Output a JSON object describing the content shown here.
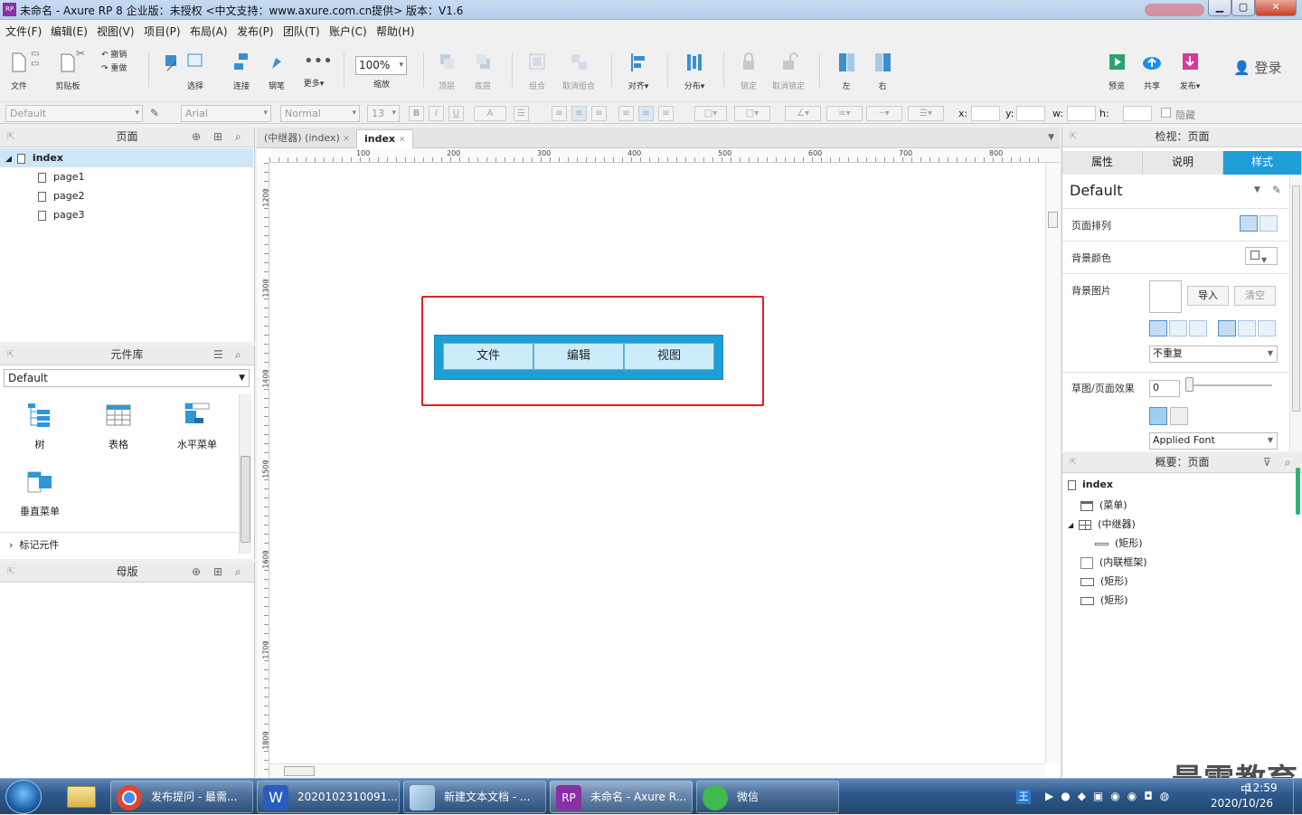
{
  "window": {
    "title": "未命名 - Axure RP 8 企业版：未授权    <中文支持：www.axure.com.cn提供> 版本：V1.6",
    "app_icon": "RP",
    "min_label": "▁",
    "max_label": "▢",
    "close_label": "✕"
  },
  "menubar": [
    "文件(F)",
    "编辑(E)",
    "视图(V)",
    "项目(P)",
    "布局(A)",
    "发布(P)",
    "团队(T)",
    "账户(C)",
    "帮助(H)"
  ],
  "toolbar": {
    "file": "文件",
    "clipboard": "剪贴板",
    "cut_icon": "✂",
    "undo": "撤销",
    "redo": "重做",
    "select": "选择",
    "connect": "连接",
    "pen": "钢笔",
    "more": "更多▾",
    "zoom_value": "100%",
    "zoom": "缩放",
    "top": "顶层",
    "bottom": "底层",
    "group": "组合",
    "ungroup": "取消组合",
    "align": "对齐▾",
    "distribute": "分布▾",
    "lock": "锁定",
    "unlock": "取消锁定",
    "left": "左",
    "right": "右",
    "preview": "预览",
    "share": "共享",
    "publish": "发布▾",
    "login": "登录"
  },
  "formatbar": {
    "style": "Default",
    "font": "Arial",
    "weight": "Normal",
    "size": "13",
    "bold": "B",
    "italic": "I",
    "underline": "U",
    "font_color": "A",
    "x_label": "x:",
    "y_label": "y:",
    "w_label": "w:",
    "h_label": "h:",
    "hidden": "隐藏"
  },
  "pages_panel": {
    "title": "页面",
    "root": "index",
    "pages": [
      "page1",
      "page2",
      "page3"
    ]
  },
  "library_panel": {
    "title": "元件库",
    "library": "Default",
    "widgets": [
      "树",
      "表格",
      "水平菜单",
      "垂直菜单"
    ],
    "section": "标记元件"
  },
  "master_panel": {
    "title": "母版"
  },
  "tabs": [
    {
      "label": "(中继器) (index)"
    },
    {
      "label": "index"
    }
  ],
  "tab_close": "✕",
  "ruler": {
    "h": [
      "100",
      "200",
      "300",
      "400",
      "500",
      "600",
      "700",
      "800"
    ],
    "v": [
      "1200",
      "1300",
      "1400",
      "1500",
      "1600",
      "1700",
      "1800"
    ]
  },
  "canvas": {
    "menu_items": [
      "文件",
      "编辑",
      "视图"
    ]
  },
  "inspector": {
    "title": "检视：页面",
    "tabs": [
      "属性",
      "说明",
      "样式"
    ],
    "style_name": "Default",
    "page_align": "页面排列",
    "bg_color": "背景颜色",
    "bg_image": "背景图片",
    "import": "导入",
    "clear": "清空",
    "repeat": "不重复",
    "sketch": "草图/页面效果",
    "sketch_value": "0",
    "font": "Applied Font"
  },
  "outline": {
    "title": "概要：页面",
    "root": "index",
    "items": [
      {
        "label": "(菜单)",
        "icon": "folder-icon"
      },
      {
        "label": "(中继器)",
        "icon": "repeater-icon"
      },
      {
        "label": "(矩形)",
        "icon": "line-icon"
      },
      {
        "label": "(内联框架)",
        "icon": "iframe-icon"
      },
      {
        "label": "(矩形)",
        "icon": "rect-icon"
      },
      {
        "label": "(矩形)",
        "icon": "rect-icon"
      }
    ]
  },
  "taskbar": {
    "tasks": [
      "发布提问 - 最需...",
      "2020102310091...",
      "新建文本文档 - ...",
      "未命名 - Axure R...",
      "微信"
    ],
    "date": "2020/10/26",
    "time": "12:59",
    "ime": "中"
  },
  "watermark": "最需教育",
  "colors": {
    "accent": "#1d9ed6",
    "selection": "#e61d24",
    "tab_active": "#1d9ed6"
  }
}
